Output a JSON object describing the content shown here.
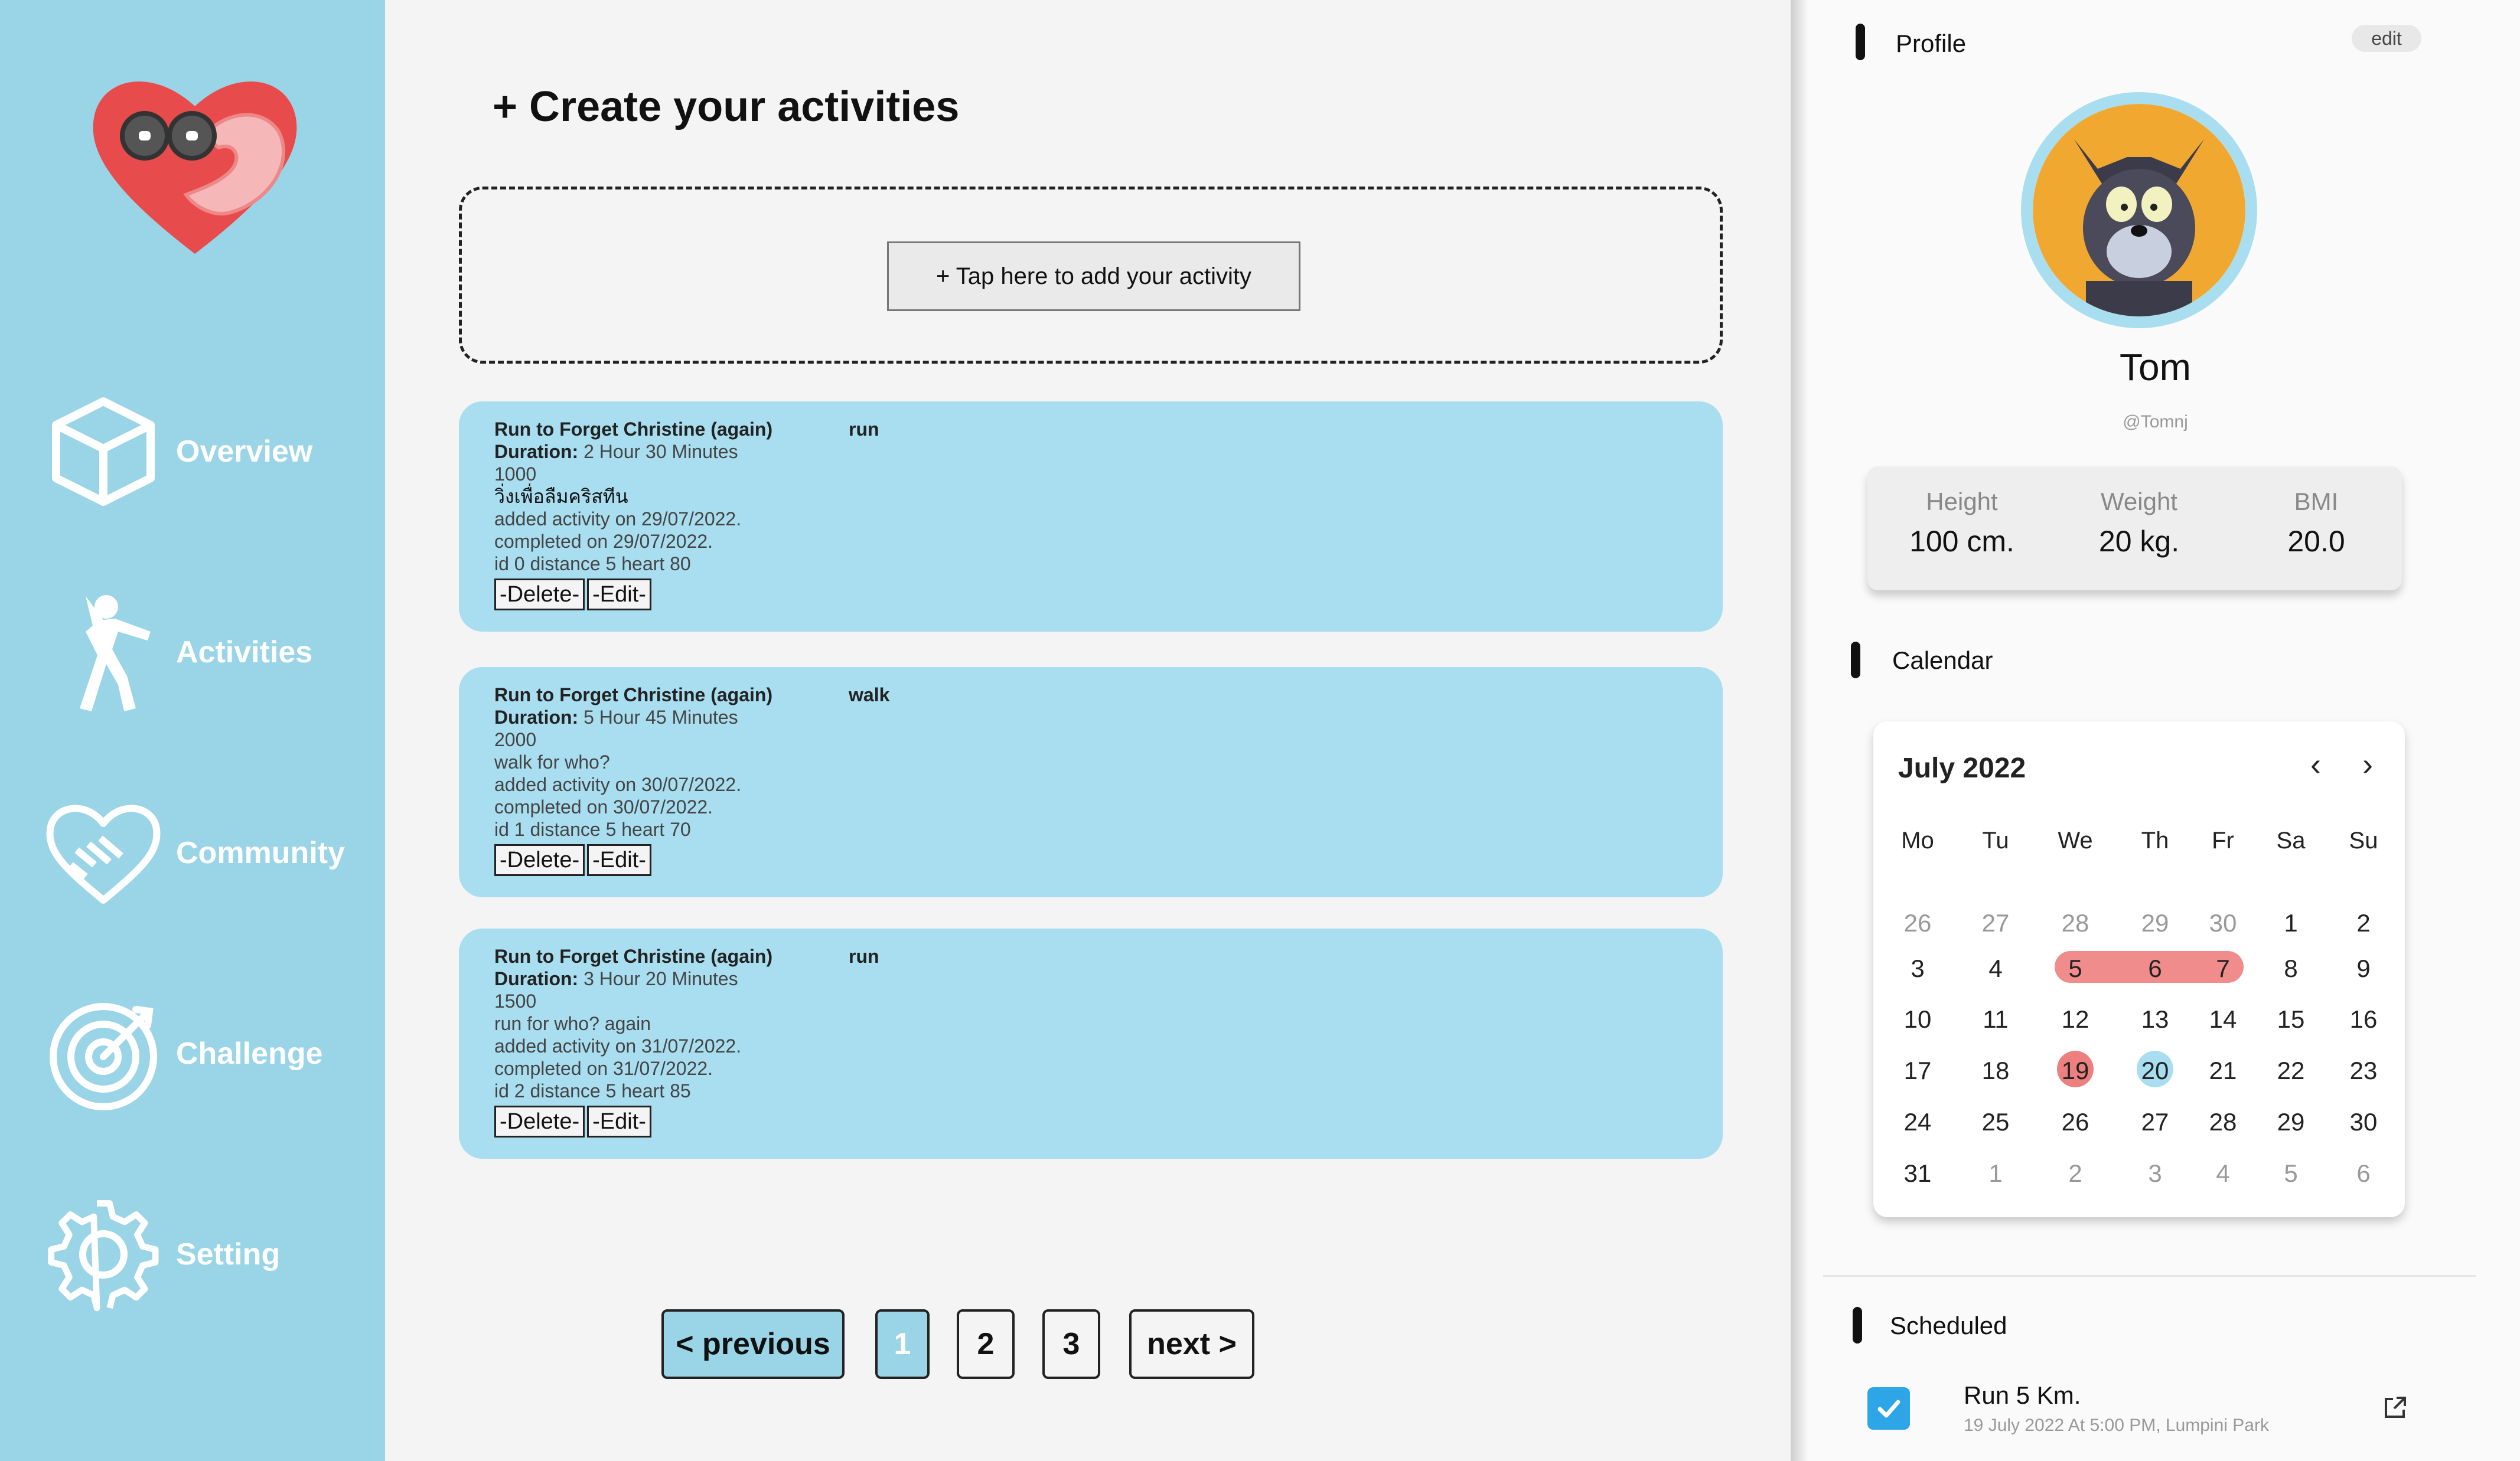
{
  "sidebar": {
    "items": [
      {
        "label": "Overview",
        "icon": "cube-icon"
      },
      {
        "label": "Activities",
        "icon": "runner-icon"
      },
      {
        "label": "Community",
        "icon": "handshake-heart-icon"
      },
      {
        "label": "Challenge",
        "icon": "target-icon"
      },
      {
        "label": "Setting",
        "icon": "gear-icon"
      }
    ]
  },
  "main": {
    "title": "+ Create your activities",
    "add_button": "+ Tap here to add your activity",
    "activities": [
      {
        "title": "Run to Forget Christine (again)",
        "type": "run",
        "duration_label": "Duration:",
        "duration": "2 Hour 30 Minutes",
        "calories": "1000",
        "note": "วิ่งเพื่อลืมคริสทีน",
        "added": "added activity on 29/07/2022.",
        "completed": "completed on 29/07/2022.",
        "meta": "id 0 distance 5 heart 80",
        "delete": "-Delete-",
        "edit": "-Edit-"
      },
      {
        "title": "Run to Forget Christine (again)",
        "type": "walk",
        "duration_label": "Duration:",
        "duration": "5 Hour 45 Minutes",
        "calories": "2000",
        "note": "walk for who?",
        "added": "added activity on 30/07/2022.",
        "completed": "completed on 30/07/2022.",
        "meta": "id 1 distance 5 heart 70",
        "delete": "-Delete-",
        "edit": "-Edit-"
      },
      {
        "title": "Run to Forget Christine (again)",
        "type": "run",
        "duration_label": "Duration:",
        "duration": "3 Hour 20 Minutes",
        "calories": "1500",
        "note": "run for who? again",
        "added": "added activity on 31/07/2022.",
        "completed": "completed on 31/07/2022.",
        "meta": "id 2 distance 5 heart 85",
        "delete": "-Delete-",
        "edit": "-Edit-"
      }
    ],
    "pagination": {
      "previous": "< previous",
      "pages": [
        "1",
        "2",
        "3"
      ],
      "current": "1",
      "next": "next >"
    }
  },
  "profile": {
    "section_title": "Profile",
    "edit": "edit",
    "name": "Tom",
    "handle": "@Tomnj",
    "stats": [
      {
        "label": "Height",
        "value": "100 cm."
      },
      {
        "label": "Weight",
        "value": "20 kg."
      },
      {
        "label": "BMI",
        "value": "20.0"
      }
    ]
  },
  "calendar": {
    "section_title": "Calendar",
    "month": "July 2022",
    "weekdays": [
      "Mo",
      "Tu",
      "We",
      "Th",
      "Fr",
      "Sa",
      "Su"
    ],
    "weeks": [
      [
        "26",
        "27",
        "28",
        "29",
        "30",
        "1",
        "2"
      ],
      [
        "3",
        "4",
        "5",
        "6",
        "7",
        "8",
        "9"
      ],
      [
        "10",
        "11",
        "12",
        "13",
        "14",
        "15",
        "16"
      ],
      [
        "17",
        "18",
        "19",
        "20",
        "21",
        "22",
        "23"
      ],
      [
        "24",
        "25",
        "26",
        "27",
        "28",
        "29",
        "30"
      ],
      [
        "31",
        "1",
        "2",
        "3",
        "4",
        "5",
        "6"
      ]
    ],
    "highlight_range": [
      "5",
      "7"
    ],
    "event_day": "19",
    "today": "20",
    "colors": {
      "range": "#f08c8c",
      "event": "#ee7f7f",
      "today": "#a8def0"
    }
  },
  "scheduled": {
    "section_title": "Scheduled",
    "items": [
      {
        "title": "Run 5 Km.",
        "subtitle": "19 July 2022 At 5:00 PM, Lumpini Park",
        "checked": true
      }
    ]
  },
  "colors": {
    "sidebar": "#9ad4e7",
    "card": "#a8def0",
    "accent": "#2ea5e6"
  }
}
